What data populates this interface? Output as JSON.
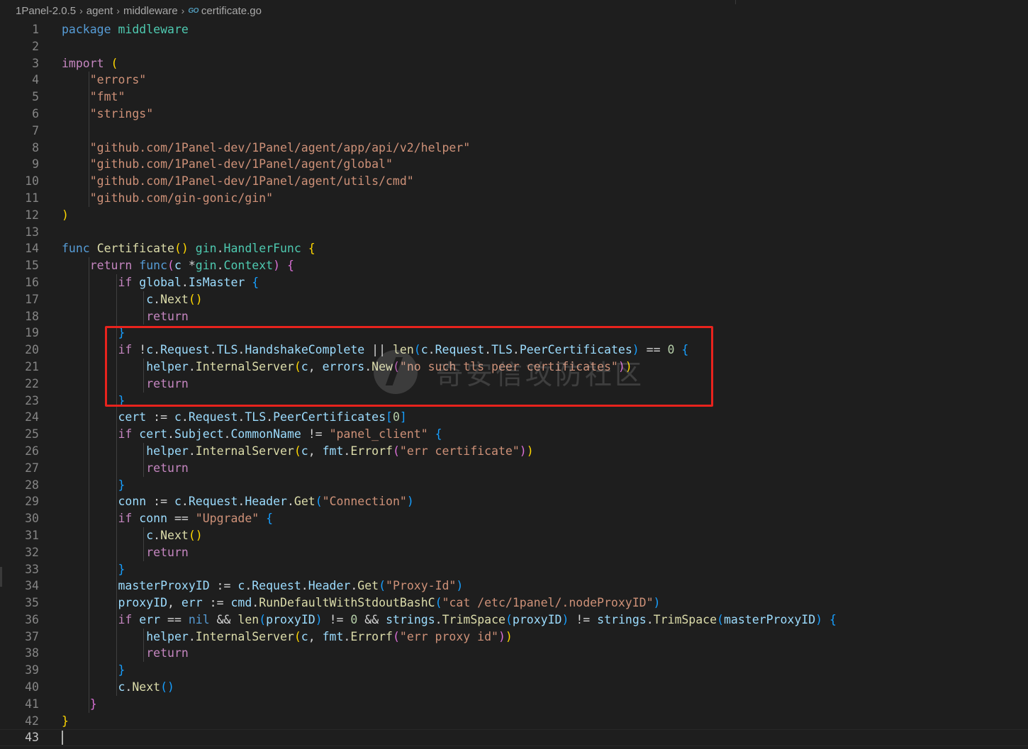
{
  "breadcrumb": {
    "root": "1Panel-2.0.5",
    "folder1": "agent",
    "folder2": "middleware",
    "file_icon": "go-file-icon",
    "file": "certificate.go",
    "separator": "›"
  },
  "editor": {
    "current_line": 43,
    "language": "go"
  },
  "watermark": {
    "text": "奇安信攻防社区"
  },
  "highlight": {
    "color": "#e8231d",
    "first_line": 19,
    "last_line": 23
  },
  "colors": {
    "background": "#1e1e1e",
    "keyword": "#569cd6",
    "control": "#c586c0",
    "string": "#ce9178",
    "function": "#dcdcaa",
    "type": "#4ec9b0",
    "variable": "#9cdcfe"
  },
  "lines": [
    [
      [
        "kw",
        "package"
      ],
      [
        "op",
        " "
      ],
      [
        "pkg",
        "middleware"
      ]
    ],
    [],
    [
      [
        "ctl",
        "import"
      ],
      [
        "op",
        " "
      ],
      [
        "b1",
        "("
      ]
    ],
    [
      [
        "op",
        "    "
      ],
      [
        "str",
        "\"errors\""
      ]
    ],
    [
      [
        "op",
        "    "
      ],
      [
        "str",
        "\"fmt\""
      ]
    ],
    [
      [
        "op",
        "    "
      ],
      [
        "str",
        "\"strings\""
      ]
    ],
    [],
    [
      [
        "op",
        "    "
      ],
      [
        "str",
        "\"github.com/1Panel-dev/1Panel/agent/app/api/v2/helper\""
      ]
    ],
    [
      [
        "op",
        "    "
      ],
      [
        "str",
        "\"github.com/1Panel-dev/1Panel/agent/global\""
      ]
    ],
    [
      [
        "op",
        "    "
      ],
      [
        "str",
        "\"github.com/1Panel-dev/1Panel/agent/utils/cmd\""
      ]
    ],
    [
      [
        "op",
        "    "
      ],
      [
        "str",
        "\"github.com/gin-gonic/gin\""
      ]
    ],
    [
      [
        "b1",
        ")"
      ]
    ],
    [],
    [
      [
        "kw",
        "func"
      ],
      [
        "op",
        " "
      ],
      [
        "fn",
        "Certificate"
      ],
      [
        "b1",
        "()"
      ],
      [
        "op",
        " "
      ],
      [
        "pkg",
        "gin"
      ],
      [
        "op",
        "."
      ],
      [
        "ty",
        "HandlerFunc"
      ],
      [
        "op",
        " "
      ],
      [
        "b1",
        "{"
      ]
    ],
    [
      [
        "op",
        "    "
      ],
      [
        "ctl",
        "return"
      ],
      [
        "op",
        " "
      ],
      [
        "kw",
        "func"
      ],
      [
        "b2",
        "("
      ],
      [
        "id",
        "c"
      ],
      [
        "op",
        " *"
      ],
      [
        "pkg",
        "gin"
      ],
      [
        "op",
        "."
      ],
      [
        "ty",
        "Context"
      ],
      [
        "b2",
        ")"
      ],
      [
        "op",
        " "
      ],
      [
        "b2",
        "{"
      ]
    ],
    [
      [
        "op",
        "        "
      ],
      [
        "ctl",
        "if"
      ],
      [
        "op",
        " "
      ],
      [
        "id",
        "global"
      ],
      [
        "op",
        "."
      ],
      [
        "id",
        "IsMaster"
      ],
      [
        "op",
        " "
      ],
      [
        "b3",
        "{"
      ]
    ],
    [
      [
        "op",
        "            "
      ],
      [
        "id",
        "c"
      ],
      [
        "op",
        "."
      ],
      [
        "fn",
        "Next"
      ],
      [
        "b1",
        "()"
      ]
    ],
    [
      [
        "op",
        "            "
      ],
      [
        "ctl",
        "return"
      ]
    ],
    [
      [
        "op",
        "        "
      ],
      [
        "b3",
        "}"
      ]
    ],
    [
      [
        "op",
        "        "
      ],
      [
        "ctl",
        "if"
      ],
      [
        "op",
        " !"
      ],
      [
        "id",
        "c"
      ],
      [
        "op",
        "."
      ],
      [
        "id",
        "Request"
      ],
      [
        "op",
        "."
      ],
      [
        "id",
        "TLS"
      ],
      [
        "op",
        "."
      ],
      [
        "id",
        "HandshakeComplete"
      ],
      [
        "op",
        " || "
      ],
      [
        "fn",
        "len"
      ],
      [
        "b3",
        "("
      ],
      [
        "id",
        "c"
      ],
      [
        "op",
        "."
      ],
      [
        "id",
        "Request"
      ],
      [
        "op",
        "."
      ],
      [
        "id",
        "TLS"
      ],
      [
        "op",
        "."
      ],
      [
        "id",
        "PeerCertificates"
      ],
      [
        "b3",
        ")"
      ],
      [
        "op",
        " == "
      ],
      [
        "num",
        "0"
      ],
      [
        "op",
        " "
      ],
      [
        "b3",
        "{"
      ]
    ],
    [
      [
        "op",
        "            "
      ],
      [
        "id",
        "helper"
      ],
      [
        "op",
        "."
      ],
      [
        "fn",
        "InternalServer"
      ],
      [
        "b1",
        "("
      ],
      [
        "id",
        "c"
      ],
      [
        "op",
        ", "
      ],
      [
        "id",
        "errors"
      ],
      [
        "op",
        "."
      ],
      [
        "fn",
        "New"
      ],
      [
        "b2",
        "("
      ],
      [
        "str",
        "\"no such tls peer certificates\""
      ],
      [
        "b2",
        ")"
      ],
      [
        "b1",
        ")"
      ]
    ],
    [
      [
        "op",
        "            "
      ],
      [
        "ctl",
        "return"
      ]
    ],
    [
      [
        "op",
        "        "
      ],
      [
        "b3",
        "}"
      ]
    ],
    [
      [
        "op",
        "        "
      ],
      [
        "id",
        "cert"
      ],
      [
        "op",
        " := "
      ],
      [
        "id",
        "c"
      ],
      [
        "op",
        "."
      ],
      [
        "id",
        "Request"
      ],
      [
        "op",
        "."
      ],
      [
        "id",
        "TLS"
      ],
      [
        "op",
        "."
      ],
      [
        "id",
        "PeerCertificates"
      ],
      [
        "b3",
        "["
      ],
      [
        "num",
        "0"
      ],
      [
        "b3",
        "]"
      ]
    ],
    [
      [
        "op",
        "        "
      ],
      [
        "ctl",
        "if"
      ],
      [
        "op",
        " "
      ],
      [
        "id",
        "cert"
      ],
      [
        "op",
        "."
      ],
      [
        "id",
        "Subject"
      ],
      [
        "op",
        "."
      ],
      [
        "id",
        "CommonName"
      ],
      [
        "op",
        " != "
      ],
      [
        "str",
        "\"panel_client\""
      ],
      [
        "op",
        " "
      ],
      [
        "b3",
        "{"
      ]
    ],
    [
      [
        "op",
        "            "
      ],
      [
        "id",
        "helper"
      ],
      [
        "op",
        "."
      ],
      [
        "fn",
        "InternalServer"
      ],
      [
        "b1",
        "("
      ],
      [
        "id",
        "c"
      ],
      [
        "op",
        ", "
      ],
      [
        "id",
        "fmt"
      ],
      [
        "op",
        "."
      ],
      [
        "fn",
        "Errorf"
      ],
      [
        "b2",
        "("
      ],
      [
        "str",
        "\"err certificate\""
      ],
      [
        "b2",
        ")"
      ],
      [
        "b1",
        ")"
      ]
    ],
    [
      [
        "op",
        "            "
      ],
      [
        "ctl",
        "return"
      ]
    ],
    [
      [
        "op",
        "        "
      ],
      [
        "b3",
        "}"
      ]
    ],
    [
      [
        "op",
        "        "
      ],
      [
        "id",
        "conn"
      ],
      [
        "op",
        " := "
      ],
      [
        "id",
        "c"
      ],
      [
        "op",
        "."
      ],
      [
        "id",
        "Request"
      ],
      [
        "op",
        "."
      ],
      [
        "id",
        "Header"
      ],
      [
        "op",
        "."
      ],
      [
        "fn",
        "Get"
      ],
      [
        "b3",
        "("
      ],
      [
        "str",
        "\"Connection\""
      ],
      [
        "b3",
        ")"
      ]
    ],
    [
      [
        "op",
        "        "
      ],
      [
        "ctl",
        "if"
      ],
      [
        "op",
        " "
      ],
      [
        "id",
        "conn"
      ],
      [
        "op",
        " == "
      ],
      [
        "str",
        "\"Upgrade\""
      ],
      [
        "op",
        " "
      ],
      [
        "b3",
        "{"
      ]
    ],
    [
      [
        "op",
        "            "
      ],
      [
        "id",
        "c"
      ],
      [
        "op",
        "."
      ],
      [
        "fn",
        "Next"
      ],
      [
        "b1",
        "()"
      ]
    ],
    [
      [
        "op",
        "            "
      ],
      [
        "ctl",
        "return"
      ]
    ],
    [
      [
        "op",
        "        "
      ],
      [
        "b3",
        "}"
      ]
    ],
    [
      [
        "op",
        "        "
      ],
      [
        "id",
        "masterProxyID"
      ],
      [
        "op",
        " := "
      ],
      [
        "id",
        "c"
      ],
      [
        "op",
        "."
      ],
      [
        "id",
        "Request"
      ],
      [
        "op",
        "."
      ],
      [
        "id",
        "Header"
      ],
      [
        "op",
        "."
      ],
      [
        "fn",
        "Get"
      ],
      [
        "b3",
        "("
      ],
      [
        "str",
        "\"Proxy-Id\""
      ],
      [
        "b3",
        ")"
      ]
    ],
    [
      [
        "op",
        "        "
      ],
      [
        "id",
        "proxyID"
      ],
      [
        "op",
        ", "
      ],
      [
        "id",
        "err"
      ],
      [
        "op",
        " := "
      ],
      [
        "id",
        "cmd"
      ],
      [
        "op",
        "."
      ],
      [
        "fn",
        "RunDefaultWithStdoutBashC"
      ],
      [
        "b3",
        "("
      ],
      [
        "str",
        "\"cat /etc/1panel/.nodeProxyID\""
      ],
      [
        "b3",
        ")"
      ]
    ],
    [
      [
        "op",
        "        "
      ],
      [
        "ctl",
        "if"
      ],
      [
        "op",
        " "
      ],
      [
        "id",
        "err"
      ],
      [
        "op",
        " == "
      ],
      [
        "kw",
        "nil"
      ],
      [
        "op",
        " && "
      ],
      [
        "fn",
        "len"
      ],
      [
        "b3",
        "("
      ],
      [
        "id",
        "proxyID"
      ],
      [
        "b3",
        ")"
      ],
      [
        "op",
        " != "
      ],
      [
        "num",
        "0"
      ],
      [
        "op",
        " && "
      ],
      [
        "id",
        "strings"
      ],
      [
        "op",
        "."
      ],
      [
        "fn",
        "TrimSpace"
      ],
      [
        "b3",
        "("
      ],
      [
        "id",
        "proxyID"
      ],
      [
        "b3",
        ")"
      ],
      [
        "op",
        " != "
      ],
      [
        "id",
        "strings"
      ],
      [
        "op",
        "."
      ],
      [
        "fn",
        "TrimSpace"
      ],
      [
        "b3",
        "("
      ],
      [
        "id",
        "masterProxyID"
      ],
      [
        "b3",
        ")"
      ],
      [
        "op",
        " "
      ],
      [
        "b3",
        "{"
      ]
    ],
    [
      [
        "op",
        "            "
      ],
      [
        "id",
        "helper"
      ],
      [
        "op",
        "."
      ],
      [
        "fn",
        "InternalServer"
      ],
      [
        "b1",
        "("
      ],
      [
        "id",
        "c"
      ],
      [
        "op",
        ", "
      ],
      [
        "id",
        "fmt"
      ],
      [
        "op",
        "."
      ],
      [
        "fn",
        "Errorf"
      ],
      [
        "b2",
        "("
      ],
      [
        "str",
        "\"err proxy id\""
      ],
      [
        "b2",
        ")"
      ],
      [
        "b1",
        ")"
      ]
    ],
    [
      [
        "op",
        "            "
      ],
      [
        "ctl",
        "return"
      ]
    ],
    [
      [
        "op",
        "        "
      ],
      [
        "b3",
        "}"
      ]
    ],
    [
      [
        "op",
        "        "
      ],
      [
        "id",
        "c"
      ],
      [
        "op",
        "."
      ],
      [
        "fn",
        "Next"
      ],
      [
        "b3",
        "()"
      ]
    ],
    [
      [
        "op",
        "    "
      ],
      [
        "b2",
        "}"
      ]
    ],
    [
      [
        "b1",
        "}"
      ]
    ],
    []
  ]
}
